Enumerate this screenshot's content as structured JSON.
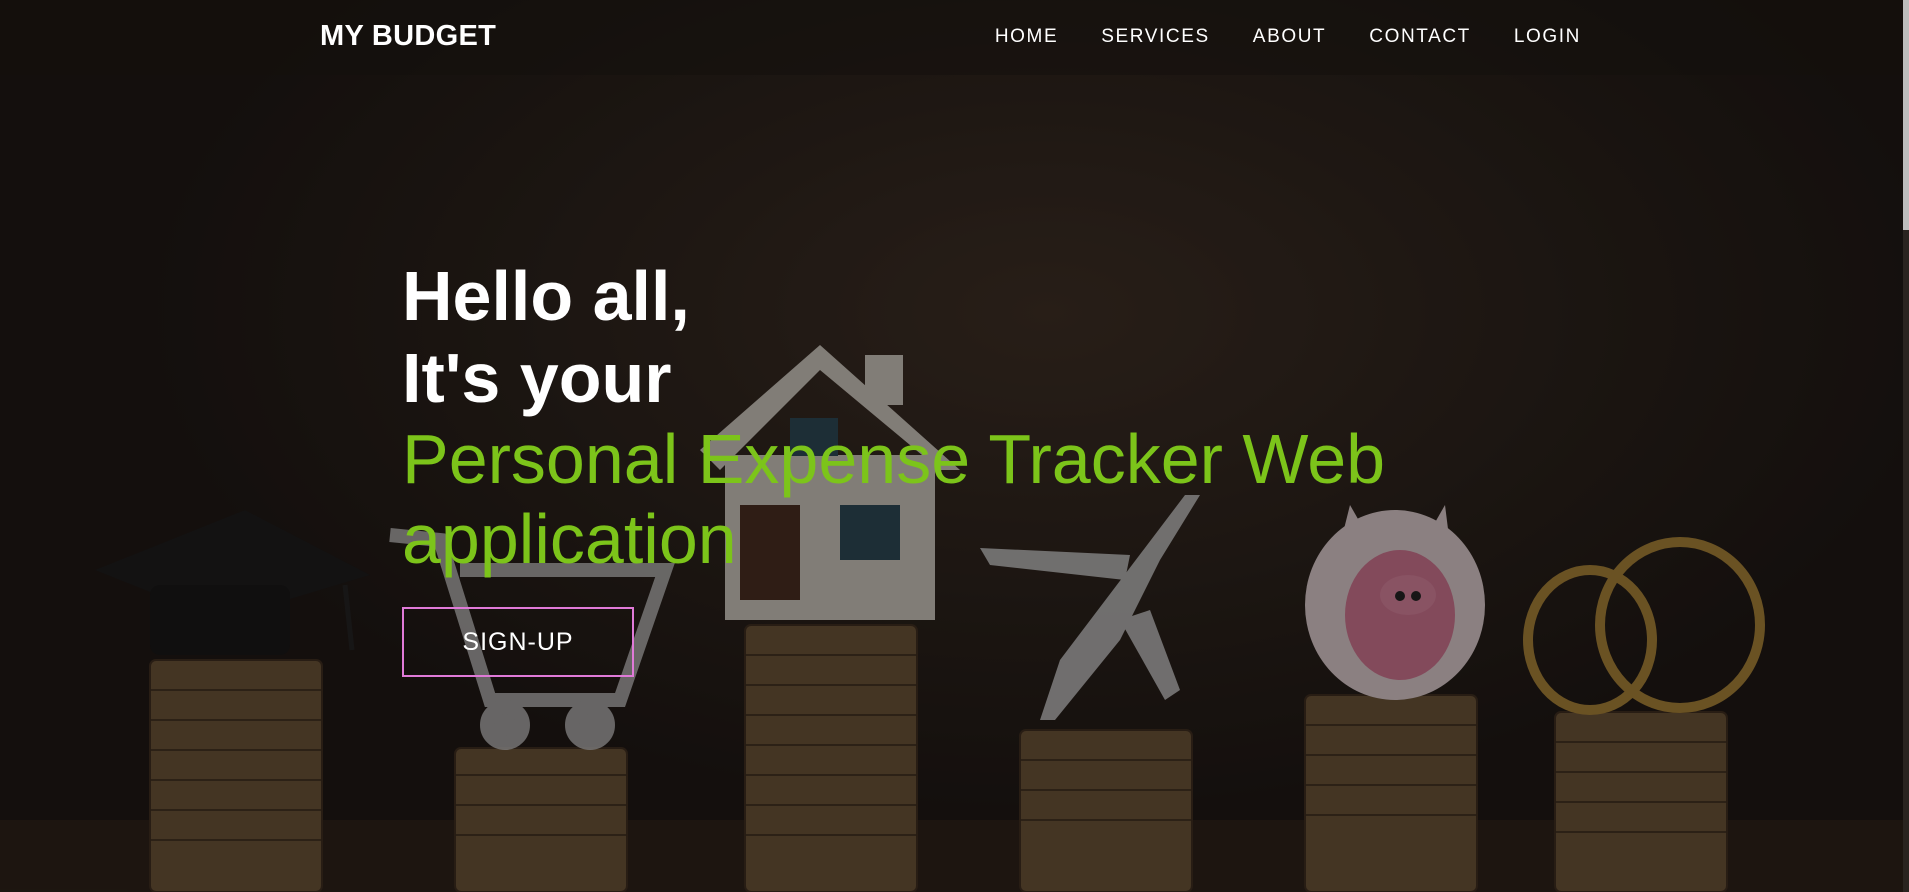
{
  "navbar": {
    "brand": "MY BUDGET",
    "links": [
      {
        "label": "HOME"
      },
      {
        "label": "SERVICES"
      },
      {
        "label": "ABOUT"
      },
      {
        "label": "CONTACT"
      },
      {
        "label": "LOGIN"
      }
    ]
  },
  "hero": {
    "line1": "Hello all,",
    "line2": "It's your",
    "highlight": "Personal Expense Tracker Web application",
    "signup_label": "SIGN-UP"
  },
  "colors": {
    "accent_green": "#7cc41a",
    "button_border": "#e07ad8",
    "text_white": "#ffffff"
  }
}
